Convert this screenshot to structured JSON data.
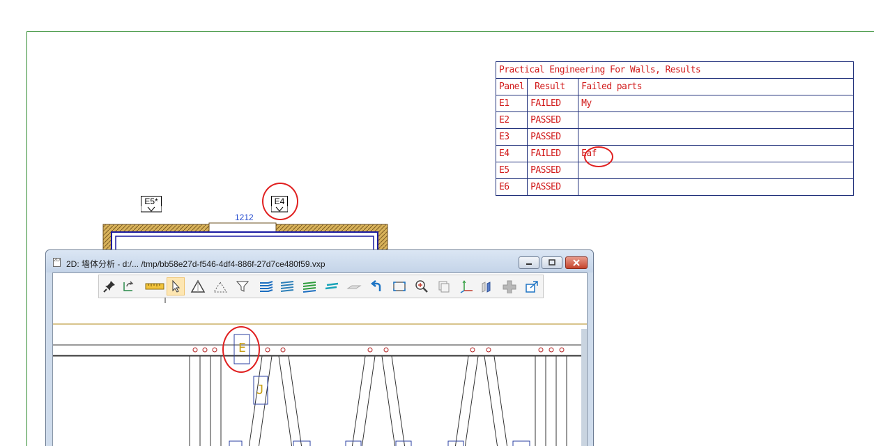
{
  "results_table": {
    "title": "Practical Engineering For Walls, Results",
    "headers": {
      "panel": "Panel",
      "result": "Result",
      "failed_parts": "Failed parts"
    },
    "rows": [
      {
        "panel": "E1",
        "result": "FAILED",
        "failed": "My"
      },
      {
        "panel": "E2",
        "result": "PASSED",
        "failed": ""
      },
      {
        "panel": "E3",
        "result": "PASSED",
        "failed": ""
      },
      {
        "panel": "E4",
        "result": "FAILED",
        "failed": "Eaf"
      },
      {
        "panel": "E5",
        "result": "PASSED",
        "failed": ""
      },
      {
        "panel": "E6",
        "result": "PASSED",
        "failed": ""
      }
    ]
  },
  "drawing": {
    "panel_tags": {
      "e5": "E5*",
      "e4": "E4"
    },
    "dimension": "1212",
    "element_labels": {
      "e": "E",
      "j": "J"
    }
  },
  "window": {
    "title": "2D: 墙体分析 - d:/... /tmp/bb58e27d-f546-4df4-886f-27d7ce480f59.vxp",
    "controls": [
      "minimize",
      "maximize",
      "close"
    ]
  },
  "toolbar": {
    "icons": [
      "pin-icon",
      "rotate-icon",
      "ruler-icon",
      "select-arrow-icon",
      "triangle-solid-icon",
      "triangle-dashed-icon",
      "filter-icon",
      "layers-blue-icon",
      "layers-multi-icon",
      "layers-green-icon",
      "layers-teal-icon",
      "plane-icon",
      "undo-icon",
      "zoom-window-icon",
      "zoom-in-icon",
      "copy-icon",
      "axes-icon",
      "panels-icon",
      "plus-icon",
      "export-icon"
    ],
    "active": "select-arrow-icon"
  },
  "colors": {
    "frame": "#2e8b2e",
    "table_text": "#d11a1a",
    "table_border": "#1f2f7a",
    "highlight": "#e02020",
    "dimension": "#2a4fd0"
  }
}
